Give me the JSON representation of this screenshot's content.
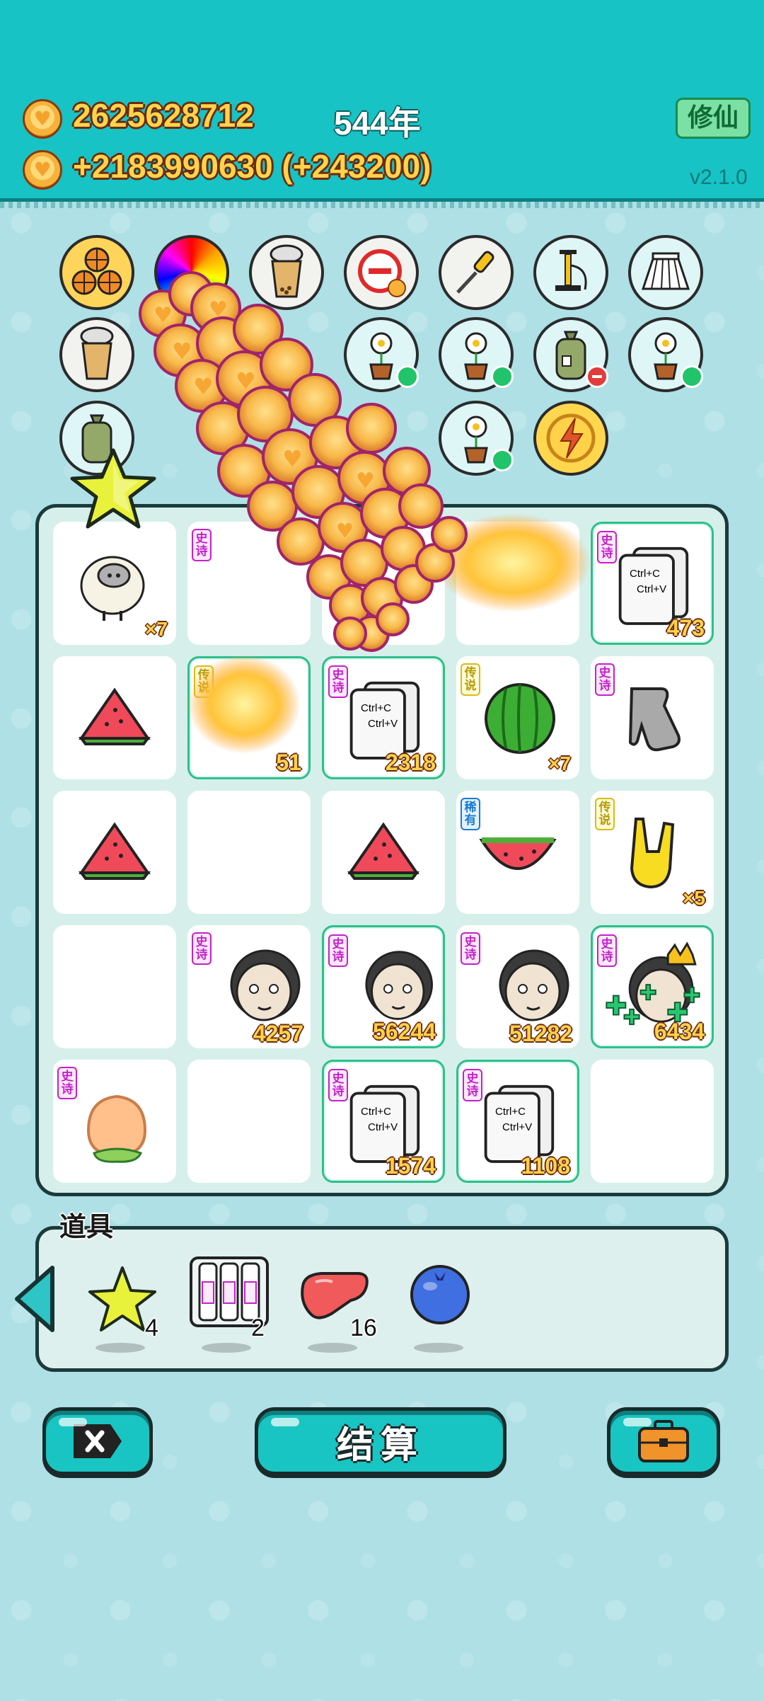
{
  "header": {
    "coins_total": "2625628712",
    "coins_gain": "+2183990630 (+243200)",
    "year": "544年",
    "xiuxian_label": "修仙",
    "version": "v2.1.0"
  },
  "items_row1": [
    "basketballs-icon",
    "rgb-ball-icon",
    "bubble-tea-icon",
    "no-entry-coin-icon",
    "screwdriver-icon",
    "pump-icon",
    "skirt-icon"
  ],
  "items_row2": [
    "bubble-tea-icon",
    "potted-flower-icon",
    "potted-flower-icon",
    "trash-bag-icon",
    "potted-flower-icon"
  ],
  "items_row3": [
    "trash-bag-icon",
    "potted-flower-icon",
    "lightning-coin-icon"
  ],
  "tags": {
    "epic": "史诗",
    "legend": "传说",
    "rare": "稀有"
  },
  "board": {
    "r1": {
      "c1_mult": "×7",
      "c5_count": "473"
    },
    "r2": {
      "c2_count": "51",
      "c3_count": "2318",
      "c4_mult": "×7"
    },
    "r3": {
      "c5_mult": "×5"
    },
    "r4": {
      "c2_count": "4257",
      "c3_count": "56244",
      "c4_count": "51282",
      "c5_count": "6434"
    },
    "r5": {
      "c3_count": "1574",
      "c4_count": "1108"
    }
  },
  "tools": {
    "label": "道具",
    "star_count": "4",
    "scroll_count": "2",
    "liver_count": "16"
  },
  "buttons": {
    "settle_label": "结算"
  },
  "copy_card_text": {
    "line1": "Ctrl+C",
    "line2": "Ctrl+V"
  },
  "colors": {
    "header": "#17c3c4",
    "background": "#aee0e6",
    "gold": "#ffd44a",
    "epic": "#c322c8"
  }
}
